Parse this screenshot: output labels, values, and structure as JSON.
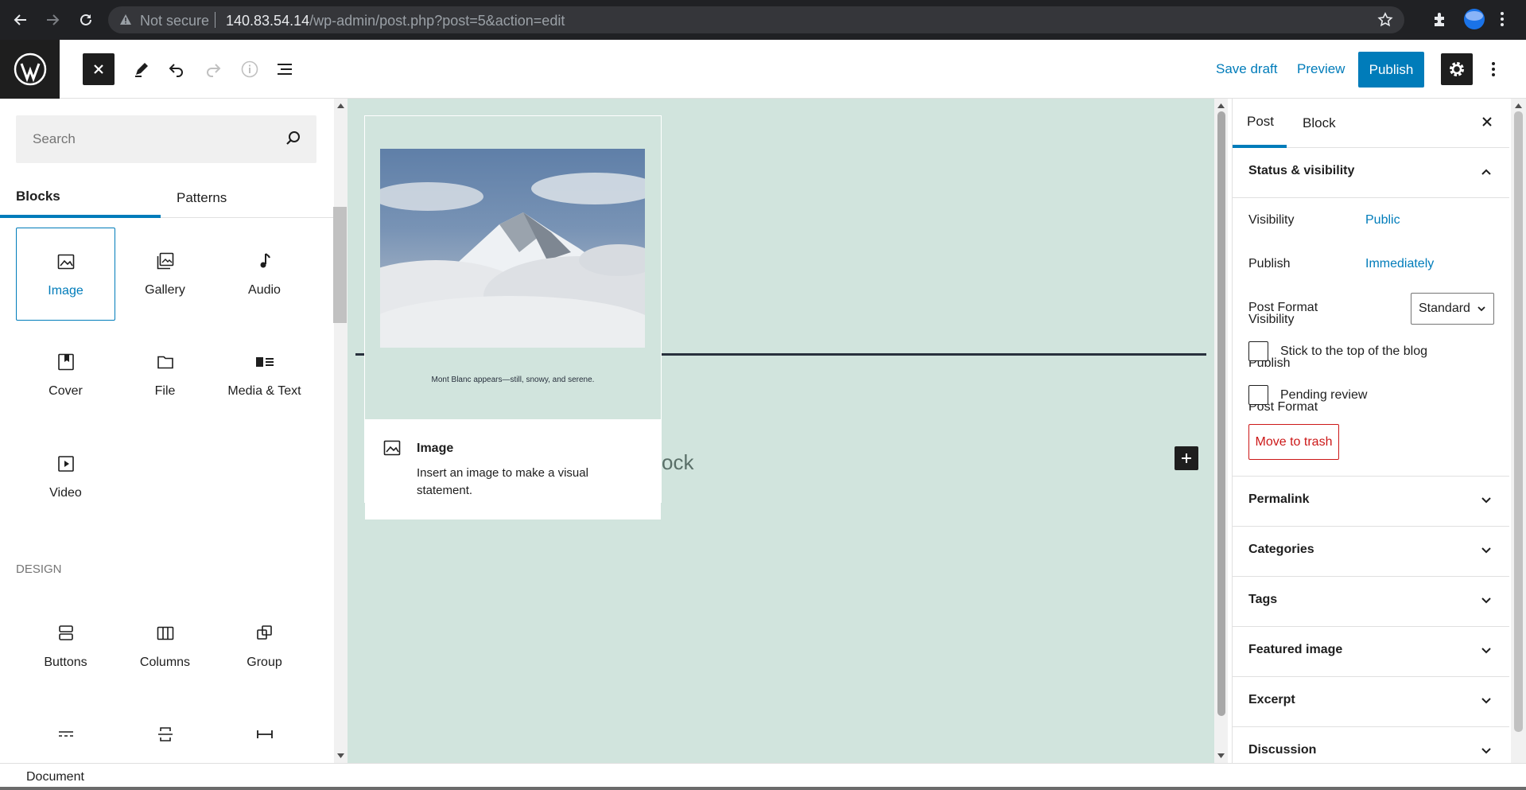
{
  "browser": {
    "security_text": "Not secure",
    "url_host": "140.83.54.14",
    "url_path": "/wp-admin/post.php?post=5&action=edit"
  },
  "header": {
    "save_draft": "Save draft",
    "preview": "Preview",
    "publish": "Publish"
  },
  "inserter": {
    "search_placeholder": "Search",
    "tabs": [
      "Blocks",
      "Patterns"
    ],
    "blocks": [
      "Image",
      "Gallery",
      "Audio",
      "Cover",
      "File",
      "Media & Text",
      "Video"
    ],
    "design_label": "DESIGN",
    "design_blocks": [
      "Buttons",
      "Columns",
      "Group"
    ]
  },
  "canvas": {
    "preview_caption": "Mont Blanc appears—still, snowy, and serene.",
    "preview_title": "Image",
    "preview_description": "Insert an image to make a visual statement.",
    "ghost_text": "ock"
  },
  "sidebar": {
    "tabs": [
      "Post",
      "Block"
    ],
    "status_title": "Status & visibility",
    "visibility_label": "Visibility",
    "visibility_value": "Public",
    "publish_label": "Publish",
    "publish_value": "Immediately",
    "format_label": "Post Format",
    "format_value": "Standard",
    "stick_label": "Stick to the top of the blog",
    "pending_label": "Pending review",
    "trash_label": "Move to trash",
    "panels": [
      "Permalink",
      "Categories",
      "Tags",
      "Featured image",
      "Excerpt",
      "Discussion"
    ]
  },
  "footer": {
    "breadcrumb": "Document"
  },
  "colors": {
    "accent": "#007cba",
    "canvas_bg": "#d1e4dd",
    "danger": "#cc1818",
    "chrome_bg": "#202124"
  }
}
